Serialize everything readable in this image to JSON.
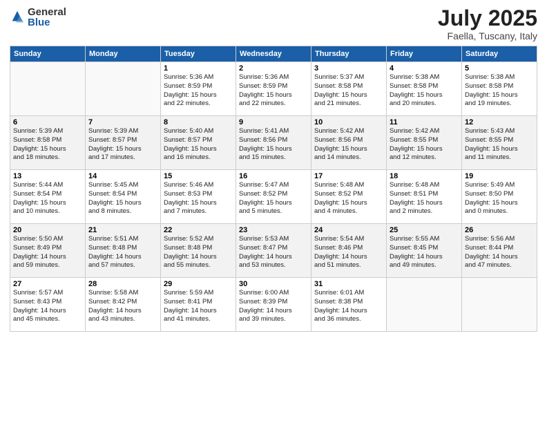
{
  "logo": {
    "general": "General",
    "blue": "Blue"
  },
  "header": {
    "month": "July 2025",
    "location": "Faella, Tuscany, Italy"
  },
  "days_of_week": [
    "Sunday",
    "Monday",
    "Tuesday",
    "Wednesday",
    "Thursday",
    "Friday",
    "Saturday"
  ],
  "weeks": [
    [
      {
        "day": "",
        "detail": ""
      },
      {
        "day": "",
        "detail": ""
      },
      {
        "day": "1",
        "detail": "Sunrise: 5:36 AM\nSunset: 8:59 PM\nDaylight: 15 hours\nand 22 minutes."
      },
      {
        "day": "2",
        "detail": "Sunrise: 5:36 AM\nSunset: 8:59 PM\nDaylight: 15 hours\nand 22 minutes."
      },
      {
        "day": "3",
        "detail": "Sunrise: 5:37 AM\nSunset: 8:58 PM\nDaylight: 15 hours\nand 21 minutes."
      },
      {
        "day": "4",
        "detail": "Sunrise: 5:38 AM\nSunset: 8:58 PM\nDaylight: 15 hours\nand 20 minutes."
      },
      {
        "day": "5",
        "detail": "Sunrise: 5:38 AM\nSunset: 8:58 PM\nDaylight: 15 hours\nand 19 minutes."
      }
    ],
    [
      {
        "day": "6",
        "detail": "Sunrise: 5:39 AM\nSunset: 8:58 PM\nDaylight: 15 hours\nand 18 minutes."
      },
      {
        "day": "7",
        "detail": "Sunrise: 5:39 AM\nSunset: 8:57 PM\nDaylight: 15 hours\nand 17 minutes."
      },
      {
        "day": "8",
        "detail": "Sunrise: 5:40 AM\nSunset: 8:57 PM\nDaylight: 15 hours\nand 16 minutes."
      },
      {
        "day": "9",
        "detail": "Sunrise: 5:41 AM\nSunset: 8:56 PM\nDaylight: 15 hours\nand 15 minutes."
      },
      {
        "day": "10",
        "detail": "Sunrise: 5:42 AM\nSunset: 8:56 PM\nDaylight: 15 hours\nand 14 minutes."
      },
      {
        "day": "11",
        "detail": "Sunrise: 5:42 AM\nSunset: 8:55 PM\nDaylight: 15 hours\nand 12 minutes."
      },
      {
        "day": "12",
        "detail": "Sunrise: 5:43 AM\nSunset: 8:55 PM\nDaylight: 15 hours\nand 11 minutes."
      }
    ],
    [
      {
        "day": "13",
        "detail": "Sunrise: 5:44 AM\nSunset: 8:54 PM\nDaylight: 15 hours\nand 10 minutes."
      },
      {
        "day": "14",
        "detail": "Sunrise: 5:45 AM\nSunset: 8:54 PM\nDaylight: 15 hours\nand 8 minutes."
      },
      {
        "day": "15",
        "detail": "Sunrise: 5:46 AM\nSunset: 8:53 PM\nDaylight: 15 hours\nand 7 minutes."
      },
      {
        "day": "16",
        "detail": "Sunrise: 5:47 AM\nSunset: 8:52 PM\nDaylight: 15 hours\nand 5 minutes."
      },
      {
        "day": "17",
        "detail": "Sunrise: 5:48 AM\nSunset: 8:52 PM\nDaylight: 15 hours\nand 4 minutes."
      },
      {
        "day": "18",
        "detail": "Sunrise: 5:48 AM\nSunset: 8:51 PM\nDaylight: 15 hours\nand 2 minutes."
      },
      {
        "day": "19",
        "detail": "Sunrise: 5:49 AM\nSunset: 8:50 PM\nDaylight: 15 hours\nand 0 minutes."
      }
    ],
    [
      {
        "day": "20",
        "detail": "Sunrise: 5:50 AM\nSunset: 8:49 PM\nDaylight: 14 hours\nand 59 minutes."
      },
      {
        "day": "21",
        "detail": "Sunrise: 5:51 AM\nSunset: 8:48 PM\nDaylight: 14 hours\nand 57 minutes."
      },
      {
        "day": "22",
        "detail": "Sunrise: 5:52 AM\nSunset: 8:48 PM\nDaylight: 14 hours\nand 55 minutes."
      },
      {
        "day": "23",
        "detail": "Sunrise: 5:53 AM\nSunset: 8:47 PM\nDaylight: 14 hours\nand 53 minutes."
      },
      {
        "day": "24",
        "detail": "Sunrise: 5:54 AM\nSunset: 8:46 PM\nDaylight: 14 hours\nand 51 minutes."
      },
      {
        "day": "25",
        "detail": "Sunrise: 5:55 AM\nSunset: 8:45 PM\nDaylight: 14 hours\nand 49 minutes."
      },
      {
        "day": "26",
        "detail": "Sunrise: 5:56 AM\nSunset: 8:44 PM\nDaylight: 14 hours\nand 47 minutes."
      }
    ],
    [
      {
        "day": "27",
        "detail": "Sunrise: 5:57 AM\nSunset: 8:43 PM\nDaylight: 14 hours\nand 45 minutes."
      },
      {
        "day": "28",
        "detail": "Sunrise: 5:58 AM\nSunset: 8:42 PM\nDaylight: 14 hours\nand 43 minutes."
      },
      {
        "day": "29",
        "detail": "Sunrise: 5:59 AM\nSunset: 8:41 PM\nDaylight: 14 hours\nand 41 minutes."
      },
      {
        "day": "30",
        "detail": "Sunrise: 6:00 AM\nSunset: 8:39 PM\nDaylight: 14 hours\nand 39 minutes."
      },
      {
        "day": "31",
        "detail": "Sunrise: 6:01 AM\nSunset: 8:38 PM\nDaylight: 14 hours\nand 36 minutes."
      },
      {
        "day": "",
        "detail": ""
      },
      {
        "day": "",
        "detail": ""
      }
    ]
  ]
}
